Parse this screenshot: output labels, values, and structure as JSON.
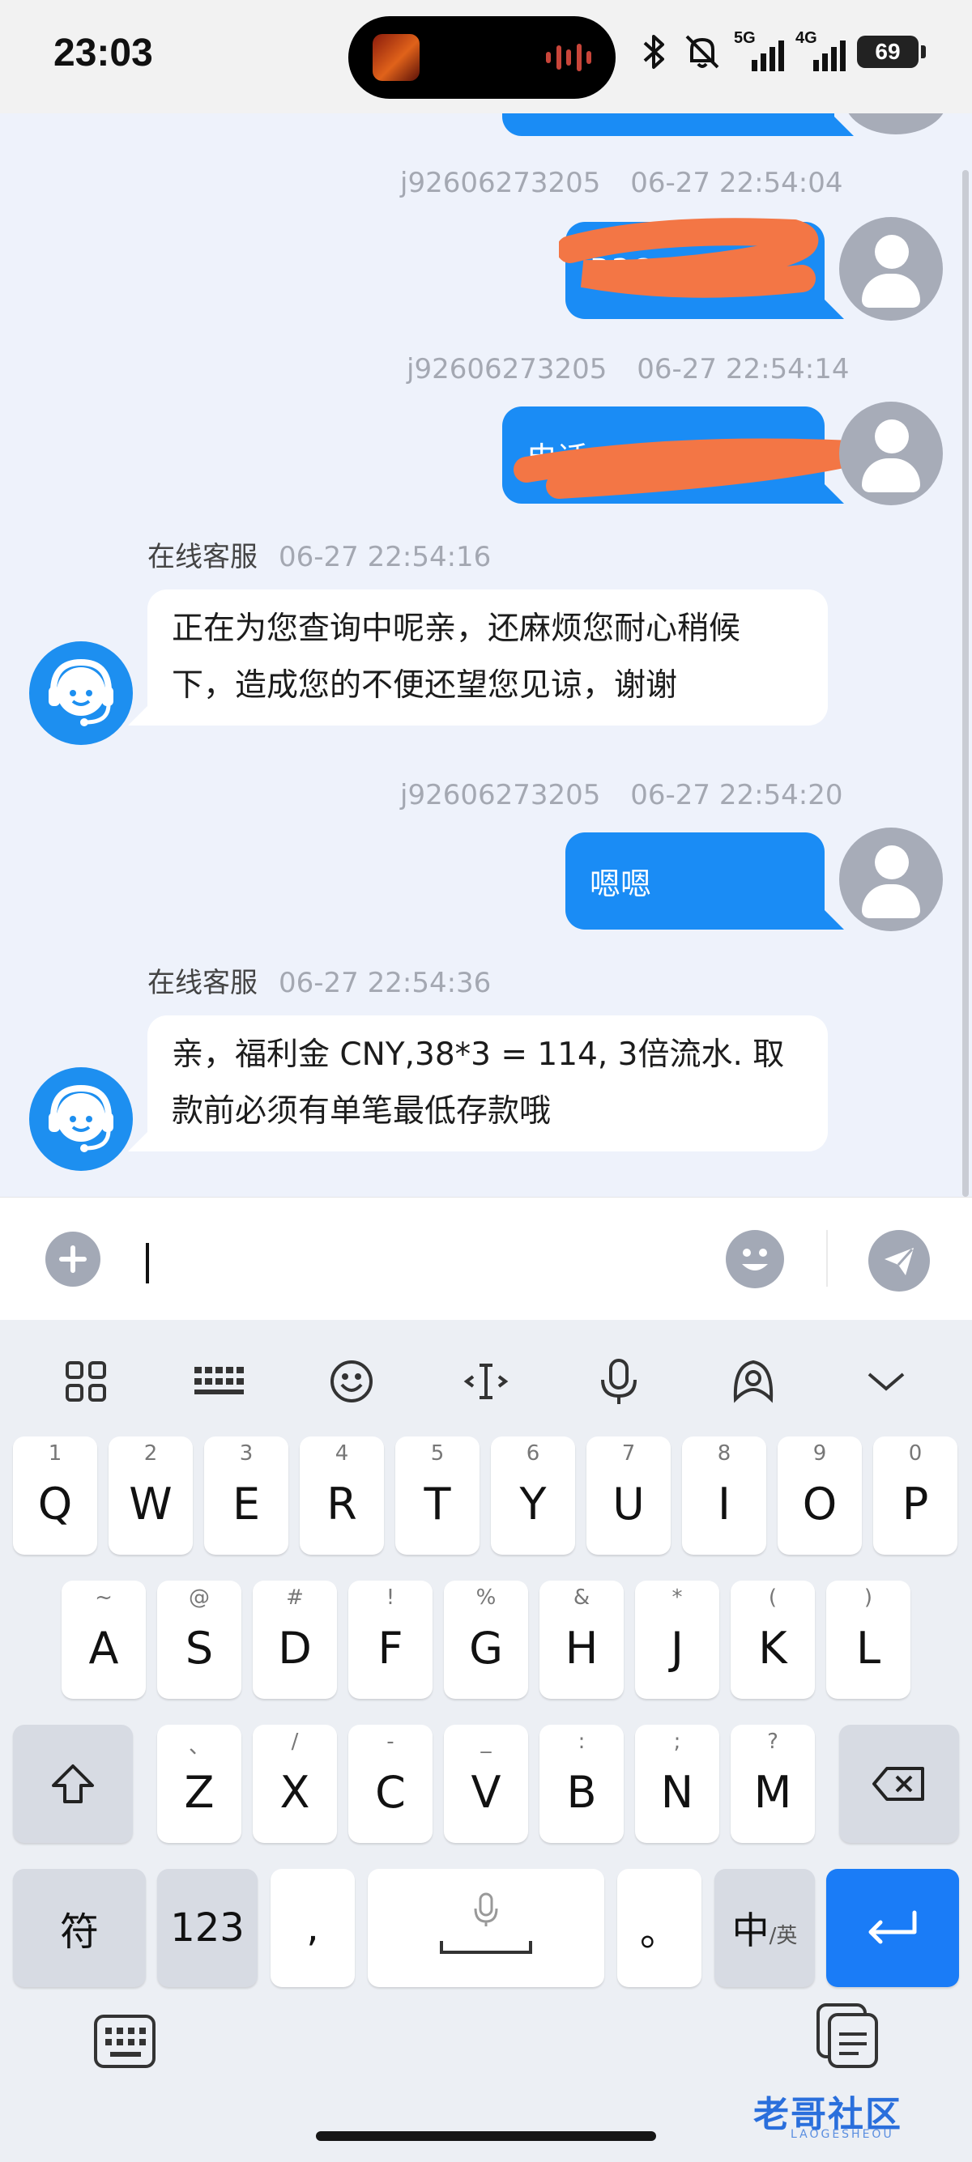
{
  "status_bar": {
    "time": "23:03",
    "network_1": "5G",
    "network_2": "4G",
    "battery": "69"
  },
  "chat": {
    "messages": [
      {
        "sender": "j92606273205",
        "time": "06-27 22:54:04",
        "text": "R3C",
        "direction": "out",
        "redacted": true
      },
      {
        "sender": "j92606273205",
        "time": "06-27 22:54:14",
        "text": "电话 1",
        "direction": "out",
        "redacted": true
      },
      {
        "sender": "在线客服",
        "time": "06-27 22:54:16",
        "text_lines": [
          "正在为您查询中呢亲，还麻烦您耐心稍候",
          "下，造成您的不便还望您见谅，谢谢"
        ],
        "direction": "in"
      },
      {
        "sender": "j92606273205",
        "time": "06-27 22:54:20",
        "text": "嗯嗯",
        "direction": "out"
      },
      {
        "sender": "在线客服",
        "time": "06-27 22:54:36",
        "text_lines": [
          "亲，福利金 CNY,38*3 = 114, 3倍流水. 取",
          "款前必须有单笔最低存款哦"
        ],
        "direction": "in"
      }
    ]
  },
  "input_bar": {
    "add_icon": "plus-icon",
    "emoji_icon": "emoji-icon",
    "send_icon": "send-icon"
  },
  "keyboard": {
    "toolbar_icons": [
      "apps-icon",
      "keyboard-layout-icon",
      "emoji-icon",
      "text-cursor-icon",
      "microphone-icon",
      "assistant-icon",
      "collapse-icon"
    ],
    "row1": [
      {
        "sub": "1",
        "main": "Q"
      },
      {
        "sub": "2",
        "main": "W"
      },
      {
        "sub": "3",
        "main": "E"
      },
      {
        "sub": "4",
        "main": "R"
      },
      {
        "sub": "5",
        "main": "T"
      },
      {
        "sub": "6",
        "main": "Y"
      },
      {
        "sub": "7",
        "main": "U"
      },
      {
        "sub": "8",
        "main": "I"
      },
      {
        "sub": "9",
        "main": "O"
      },
      {
        "sub": "0",
        "main": "P"
      }
    ],
    "row2": [
      {
        "sub": "~",
        "main": "A"
      },
      {
        "sub": "@",
        "main": "S"
      },
      {
        "sub": "#",
        "main": "D"
      },
      {
        "sub": "!",
        "main": "F"
      },
      {
        "sub": "%",
        "main": "G"
      },
      {
        "sub": "&",
        "main": "H"
      },
      {
        "sub": "*",
        "main": "J"
      },
      {
        "sub": "(",
        "main": "K"
      },
      {
        "sub": ")",
        "main": "L"
      }
    ],
    "row3": [
      {
        "sub": "、",
        "main": "Z"
      },
      {
        "sub": "/",
        "main": "X"
      },
      {
        "sub": "-",
        "main": "C"
      },
      {
        "sub": "_",
        "main": "V"
      },
      {
        "sub": ":",
        "main": "B"
      },
      {
        "sub": ";",
        "main": "N"
      },
      {
        "sub": "?",
        "main": "M"
      }
    ],
    "symbols_label": "符",
    "numbers_label": "123",
    "comma_label": ",",
    "period_label": "。",
    "lang_main": "中",
    "lang_sub": "/英"
  },
  "watermark": {
    "text": "老哥社区",
    "sub": "LAOGESHEOU"
  },
  "colors": {
    "accent": "#1a8cf5",
    "enter_key": "#1a7cf7",
    "agent_avatar": "#1d8ff0",
    "redaction": "#f37645"
  }
}
